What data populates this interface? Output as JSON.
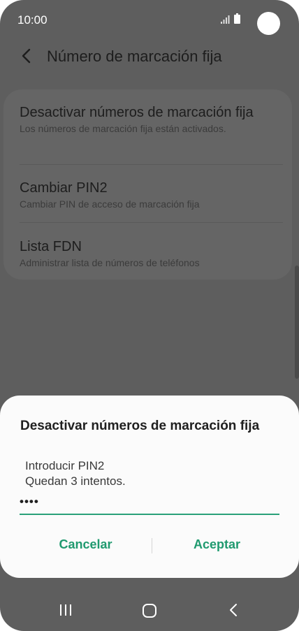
{
  "status_bar": {
    "time": "10:00",
    "signal_icon": "signal-icon",
    "battery_icon": "battery-icon"
  },
  "header": {
    "title": "Número de marcación fija",
    "back_icon": "chevron-left-icon"
  },
  "settings": {
    "items": [
      {
        "title": "Desactivar números de marcación fija",
        "subtitle": "Los números de marcación fija están activados."
      },
      {
        "title": "Cambiar PIN2",
        "subtitle": "Cambiar PIN de acceso de marcación fija"
      },
      {
        "title": "Lista FDN",
        "subtitle": "Administrar lista de números de teléfonos"
      }
    ]
  },
  "dialog": {
    "title": "Desactivar números de marcación fija",
    "prompt_line1": "Introducir PIN2",
    "prompt_line2": "Quedan 3 intentos.",
    "pin_value": "••••",
    "cancel_label": "Cancelar",
    "accept_label": "Aceptar"
  },
  "colors": {
    "accent": "#1f9a6f",
    "dim_background": "#5e5e5e",
    "dialog_background": "#fbfbfb"
  },
  "nav_bar": {
    "recent_icon": "recent-apps-icon",
    "home_icon": "home-icon",
    "back_icon": "back-icon"
  }
}
